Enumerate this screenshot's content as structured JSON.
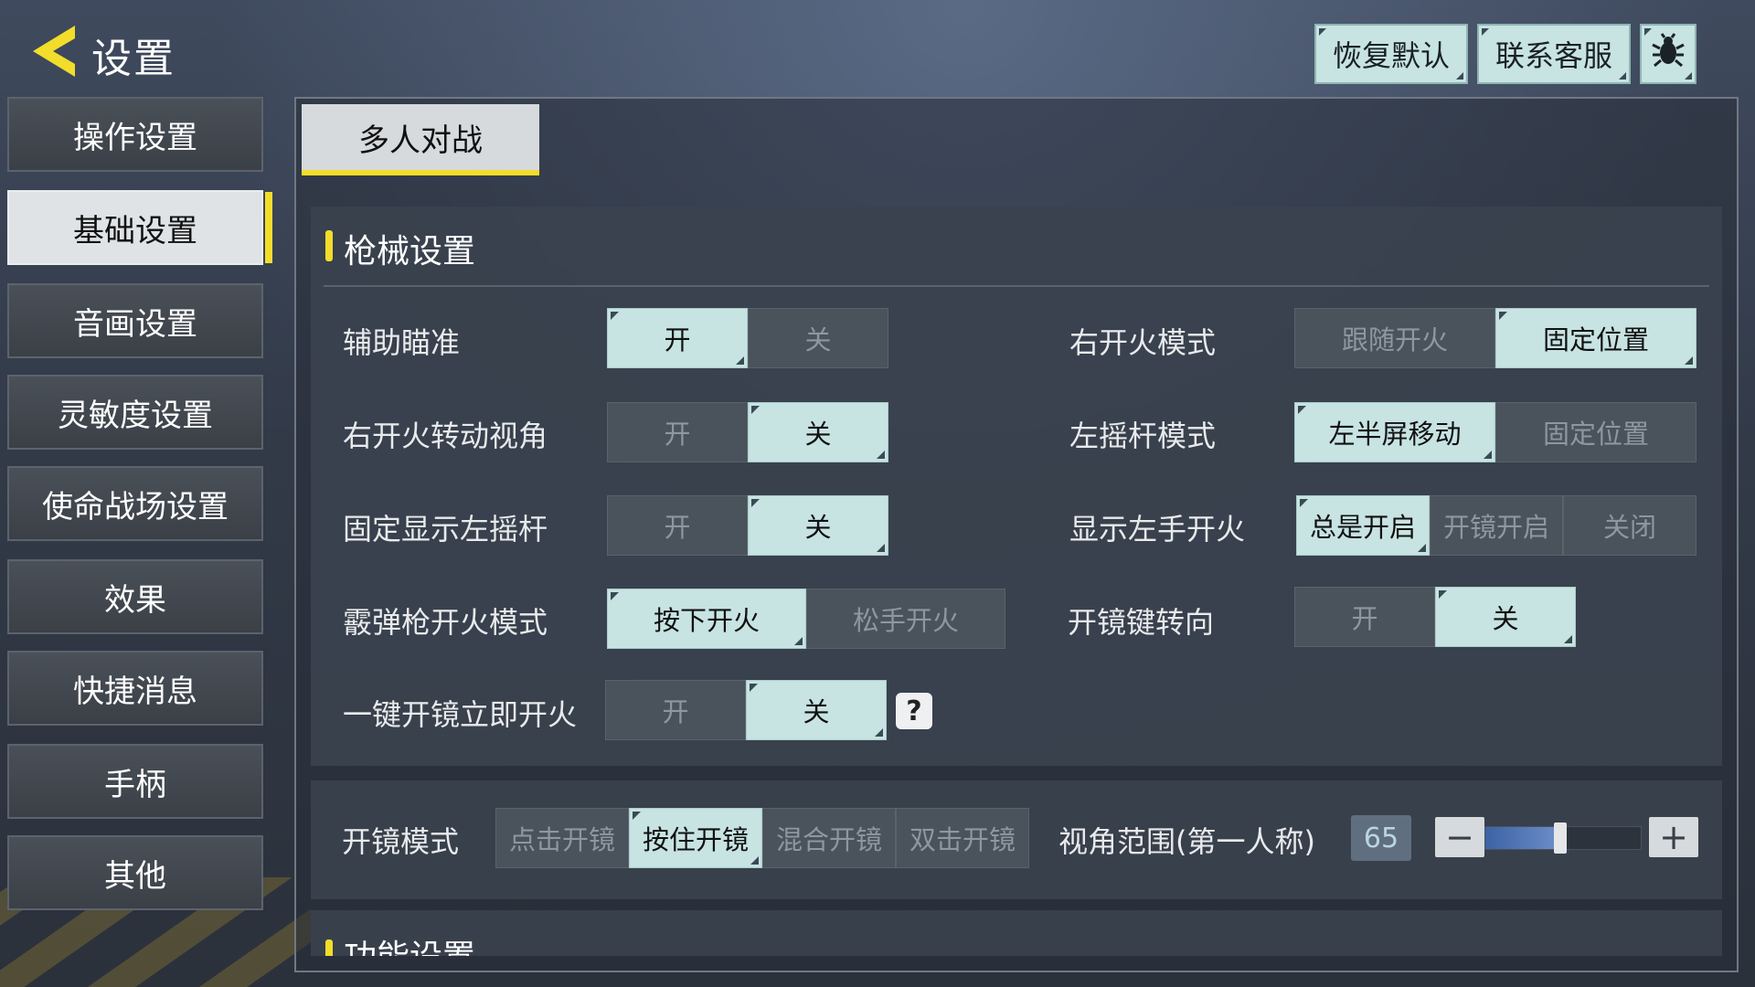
{
  "header": {
    "title": "设置",
    "restore_default": "恢复默认",
    "contact_support": "联系客服"
  },
  "sidebar": {
    "items": [
      {
        "label": "操作设置"
      },
      {
        "label": "基础设置",
        "active": true
      },
      {
        "label": "音画设置"
      },
      {
        "label": "灵敏度设置"
      },
      {
        "label": "使命战场设置"
      },
      {
        "label": "效果"
      },
      {
        "label": "快捷消息"
      },
      {
        "label": "手柄"
      },
      {
        "label": "其他"
      }
    ]
  },
  "tab": {
    "label": "多人对战"
  },
  "weapon_section": {
    "title": "枪械设置",
    "rows": {
      "aim_assist": {
        "label": "辅助瞄准",
        "options": [
          "开",
          "关"
        ],
        "selected": "开"
      },
      "right_fire_rotate": {
        "label": "右开火转动视角",
        "options": [
          "开",
          "关"
        ],
        "selected": "关"
      },
      "fixed_left_stick": {
        "label": "固定显示左摇杆",
        "options": [
          "开",
          "关"
        ],
        "selected": "关"
      },
      "shotgun_fire_mode": {
        "label": "霰弹枪开火模式",
        "options": [
          "按下开火",
          "松手开火"
        ],
        "selected": "按下开火"
      },
      "one_tap_scope_fire": {
        "label": "一键开镜立即开火",
        "options": [
          "开",
          "关"
        ],
        "selected": "关"
      },
      "right_fire_mode": {
        "label": "右开火模式",
        "options": [
          "跟随开火",
          "固定位置"
        ],
        "selected": "固定位置"
      },
      "left_stick_mode": {
        "label": "左摇杆模式",
        "options": [
          "左半屏移动",
          "固定位置"
        ],
        "selected": "左半屏移动"
      },
      "left_hand_fire": {
        "label": "显示左手开火",
        "options": [
          "总是开启",
          "开镜开启",
          "关闭"
        ],
        "selected": "总是开启"
      },
      "scope_key_turn": {
        "label": "开镜键转向",
        "options": [
          "开",
          "关"
        ],
        "selected": "关"
      }
    },
    "help_icon": "?"
  },
  "scope_section": {
    "label": "开镜模式",
    "options": [
      "点击开镜",
      "按住开镜",
      "混合开镜",
      "双击开镜"
    ],
    "selected": "按住开镜",
    "fov_label": "视角范围(第一人称)",
    "fov_value": "65",
    "fov_slider_fraction": 0.48,
    "minus": "−",
    "plus": "+"
  },
  "function_section": {
    "title": "功能设置"
  },
  "colors": {
    "accent_yellow": "#f2dd2b",
    "selected_option": "#c7e3e2",
    "unselected_option": "#4a525c",
    "slider_fill": "#4f74b6"
  },
  "icons": {
    "back": "back-arrow-icon",
    "bug": "bug-icon"
  }
}
